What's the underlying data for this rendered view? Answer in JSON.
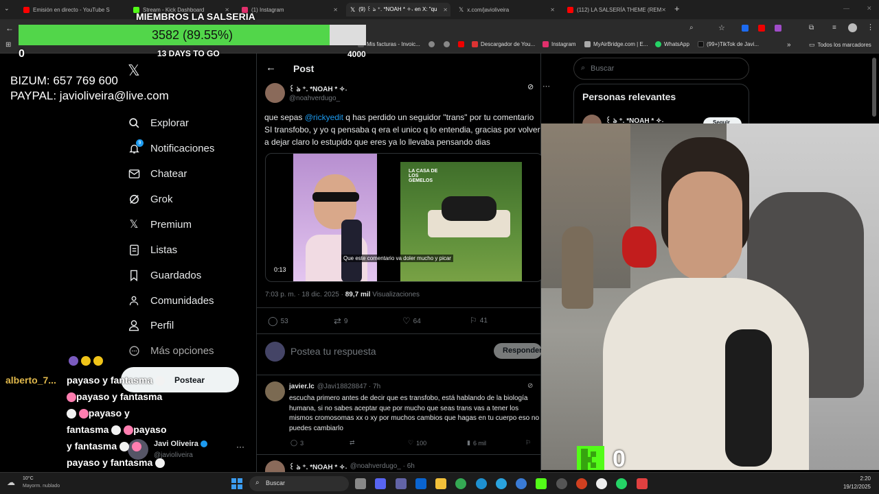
{
  "browser": {
    "tabs": [
      {
        "label": "Emisión en directo - YouTube S",
        "color": "#ff0000"
      },
      {
        "label": "Stream - Kick Dashboard",
        "color": "#53fc18"
      },
      {
        "label": "(1) Instagram",
        "color": "#e1306c"
      },
      {
        "label": "(9) ꒰ ঌ ⁺. *NOAH * ✧˖ en X: \"qu",
        "color": "#ffffff"
      },
      {
        "label": "x.com/javioliveira",
        "color": "#ffffff"
      },
      {
        "label": "(112) LA SALSERÍA THEME (REM",
        "color": "#ff0000"
      }
    ],
    "bookmarks": [
      "Mis facturas - Invoic...",
      "Descargador de You...",
      "Instagram",
      "MyAirBridge.com | E...",
      "WhatsApp",
      "(99+)TikTok de Javi...",
      "Todos los marcadores"
    ]
  },
  "overlay": {
    "goal_title": "MIEMBROS LA SALSERIA",
    "goal_text": "3582 (89.55%)",
    "goal_progress": 0.8955,
    "goal_min": "0",
    "goal_max": "4000",
    "days_left": "13 DAYS TO GO",
    "bizum": "BIZUM: 657 769 600",
    "paypal": "PAYPAL: javioliveira@live.com"
  },
  "nav": {
    "items": [
      {
        "label": "Explorar",
        "icon": "search-icon"
      },
      {
        "label": "Notificaciones",
        "icon": "bell-icon",
        "badge": "9"
      },
      {
        "label": "Chatear",
        "icon": "mail-icon"
      },
      {
        "label": "Grok",
        "icon": "grok-icon"
      },
      {
        "label": "Premium",
        "icon": "x-logo-icon"
      },
      {
        "label": "Listas",
        "icon": "list-icon"
      },
      {
        "label": "Guardados",
        "icon": "bookmark-icon"
      },
      {
        "label": "Comunidades",
        "icon": "communities-icon"
      },
      {
        "label": "Perfil",
        "icon": "person-icon"
      },
      {
        "label": "Más opciones",
        "icon": "more-icon"
      }
    ],
    "post_button": "Postear",
    "account_name": "Javi Oliveira",
    "account_handle": "@javioliveira"
  },
  "chat": {
    "user": "alberto_7...",
    "messages": [
      "payaso y fantasma",
      "payaso y fantasma",
      "payaso y",
      "fantasma",
      "payaso",
      "y fantasma",
      "payaso y fantasma"
    ]
  },
  "post": {
    "header": "Post",
    "author_name": "꒰ ঌ ⁺. *NOAH * ✧˖",
    "author_handle": "@noahverdugo_",
    "text_pre": "que sepas ",
    "mention": "@rickyedit",
    "text_post": " q has perdido un seguidor \"trans\" por tu comentario SI transfobo, y yo q pensaba q era el unico q lo entendia, gracias por volver a dejar claro lo estupido que eres ya lo llevaba pensando dias",
    "video_time": "0:13",
    "video_caption": "Que este comentario va doler mucho y picar",
    "video_logo": "LA CASA DE LOS GEMELOS",
    "timestamp": "7:03 p. m. · 18 dic. 2025 · ",
    "views_count": "89,7 mil",
    "views_label": " Visualizaciones",
    "replies": "53",
    "reposts": "9",
    "likes": "64",
    "bookmarks": "41",
    "reply_placeholder": "Postea tu respuesta",
    "reply_button": "Responder"
  },
  "reply1": {
    "name": "javier.lc",
    "handle_time": "@Javi18828847 · 7h",
    "text": "escucha primero antes de decir que es transfobo, está hablando de la biología humana, si no sabes aceptar que por mucho que seas trans vas a tener los mismos cromosomas xx o xy por muchos cambios que hagas en tu cuerpo eso no puedes cambiarlo",
    "replies": "3",
    "likes": "100",
    "views": "6 mil"
  },
  "reply2": {
    "name": "꒰ ঌ ⁺. *NOAH * ✧˖",
    "handle_time": "@noahverdugo_ · 6h"
  },
  "right": {
    "search_placeholder": "Buscar",
    "relevant_title": "Personas relevantes",
    "relevant_name": "꒰ ঌ ⁺. *NOAH * ✧˖",
    "follow": "Seguir"
  },
  "cam": {
    "kick_count": "0"
  },
  "taskbar": {
    "weather_temp": "10°C",
    "weather_desc": "Mayorm. nublado",
    "search": "Buscar",
    "time": "2:20",
    "date": "19/12/2025"
  }
}
